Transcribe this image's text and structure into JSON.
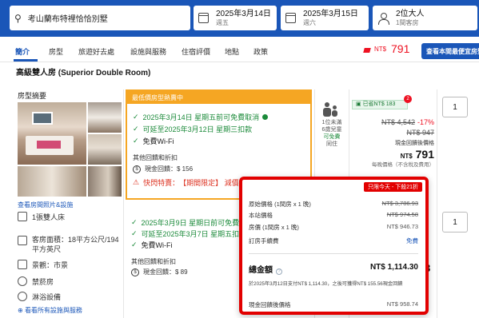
{
  "search": {
    "destination": "考山蘭布特裡恰恰別墅",
    "checkin_date": "2025年3月14日",
    "checkin_day": "週五",
    "checkout_date": "2025年3月15日",
    "checkout_day": "週六",
    "guests": "2位大人",
    "rooms": "1間客房"
  },
  "nav": {
    "tabs": [
      "簡介",
      "房型",
      "旅遊好去處",
      "設施與服務",
      "住宿評價",
      "地點",
      "政策"
    ],
    "price_label": "NT$",
    "price": "791",
    "book_button": "查看本間最便宜房型"
  },
  "room": {
    "title": "高級雙人房 (Superior Double Room)",
    "overview_label": "房型摘要",
    "photos_link": "查看房間照片&設施",
    "features": {
      "bed": "1張雙人床",
      "area": "客房面積：18平方公尺/194平方英尺",
      "view": "景觀：市景",
      "no_smoking": "禁菸房",
      "shower": "淋浴設備"
    },
    "all_facilities_link": "看看所有設施與服務"
  },
  "offer1": {
    "header": "最低價房型熱賣中",
    "free_cancel": "2025年3月14日 星期五前可免費取消",
    "pay_later": "可延至2025年3月12日 星期三扣款",
    "wifi": "免費Wi-Fi",
    "other_label": "其他回饋和折扣",
    "cash_back": "現金回饋：$ 156",
    "flash_prefix": "快閃特賣：",
    "flash_highlight": "【期間限定】 減價",
    "occupancy_line1": "1位未滿",
    "occupancy_line2": "6歲兒童",
    "occupancy_line3": "可免費",
    "occupancy_line4": "同住",
    "saved": "已省NT$ 183",
    "saved_count": "2",
    "original_price": "NT$ 4,542",
    "discount": "-17%",
    "second_price": "NT$ 947",
    "after_cashback_label": "現金回饋後價格",
    "currency": "NT$",
    "final_price": "791",
    "note": "每晚價格（不含稅及費用）",
    "qty": "1"
  },
  "offer2": {
    "free_cancel": "2025年3月9日 星期日前可免費",
    "pay_later": "可延至2025年3月7日 星期五扣",
    "wifi": "免費Wi-Fi",
    "other_label": "其他回饋和折扣",
    "cash_back": "現金回饋：$ 89",
    "qty": "1",
    "price_fragment": "3"
  },
  "popup": {
    "badge": "只限今天 - 下殺21折",
    "rows": [
      {
        "label": "原始價格 (1間房 x 1 晚)",
        "value": "NT$ 3,786.93"
      },
      {
        "label": "本站價格",
        "value": "NT$ 974.58"
      },
      {
        "label": "房價 (1間房 x 1 晚)",
        "value": "NT$ 946.73"
      },
      {
        "label": "訂房手續費",
        "value": "免費"
      }
    ],
    "total_label": "總金額",
    "total_value": "NT$ 1,114.30",
    "note": "於2025年3月12日支付NT$ 1,114.30，之後可獲得NT$ 155.56現金回饋",
    "after_label": "現金回饋後價格",
    "after_value": "NT$ 958.74"
  },
  "colors": {
    "brand_blue": "#1a56b8",
    "accent_orange": "#f5a623",
    "alert_red": "#e20000",
    "success_green": "#1b8a3a"
  }
}
